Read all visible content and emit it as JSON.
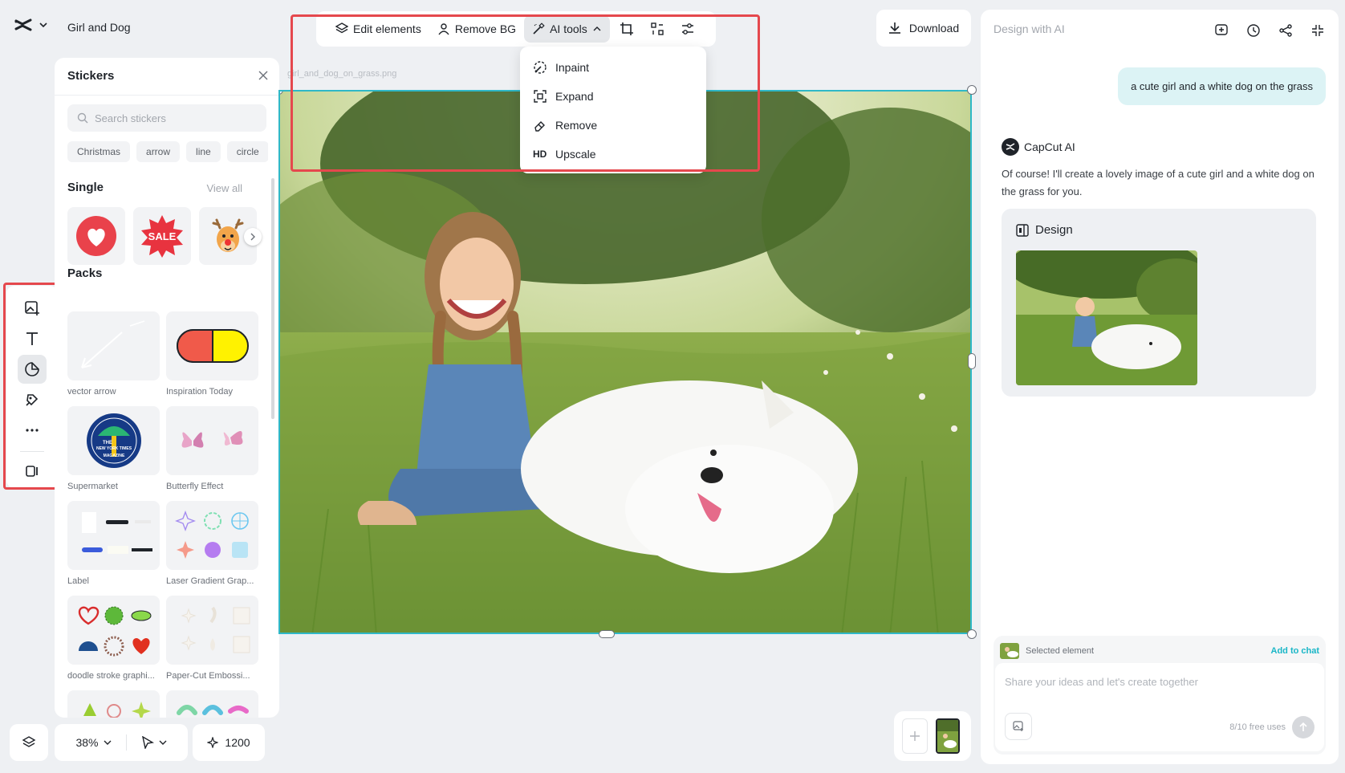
{
  "project": {
    "name": "Girl and Dog"
  },
  "toolbar": {
    "edit_elements": "Edit elements",
    "remove_bg": "Remove BG",
    "ai_tools": "AI tools"
  },
  "ai_tools_menu": {
    "items": [
      {
        "label": "Inpaint",
        "icon": "inpaint-icon"
      },
      {
        "label": "Expand",
        "icon": "expand-icon"
      },
      {
        "label": "Remove",
        "icon": "eraser-icon"
      },
      {
        "label": "Upscale",
        "icon": "hd-icon",
        "prefix": "HD"
      }
    ]
  },
  "download": {
    "label": "Download"
  },
  "canvas": {
    "file_name": "girl_and_dog_on_grass.png"
  },
  "stickers": {
    "title": "Stickers",
    "search_placeholder": "Search stickers",
    "chips": [
      "Christmas",
      "arrow",
      "line",
      "circle"
    ],
    "single_title": "Single",
    "view_all": "View all",
    "single_items": [
      "heart-sticker",
      "sale-sticker",
      "reindeer-sticker"
    ],
    "packs_title": "Packs",
    "packs": [
      {
        "label": "vector arrow"
      },
      {
        "label": "Inspiration Today"
      },
      {
        "label": "Supermarket"
      },
      {
        "label": "Butterfly Effect"
      },
      {
        "label": "Label"
      },
      {
        "label": "Laser Gradient Grap..."
      },
      {
        "label": "doodle stroke graphi..."
      },
      {
        "label": "Paper-Cut Embossi..."
      }
    ],
    "badge_text": {
      "top": "THE",
      "mid": "NEW YORK TIMES",
      "bottom": "MAGAZINE"
    }
  },
  "right_panel": {
    "title": "Design with AI",
    "user_message": "a cute girl and a white dog on the grass",
    "ai_name": "CapCut AI",
    "ai_message": "Of course! I'll create a lovely image of a cute girl and a white dog on the grass for you.",
    "design_label": "Design",
    "selected_element": "Selected element",
    "add_to_chat": "Add to chat",
    "input_placeholder": "Share your ideas and let's create together",
    "free_uses": "8/10 free uses"
  },
  "bottom_bar": {
    "zoom": "38%",
    "credits": "1200"
  },
  "colors": {
    "accent": "#19b6c7",
    "selection": "#2fb8c7",
    "highlight_box": "#e5484d"
  }
}
